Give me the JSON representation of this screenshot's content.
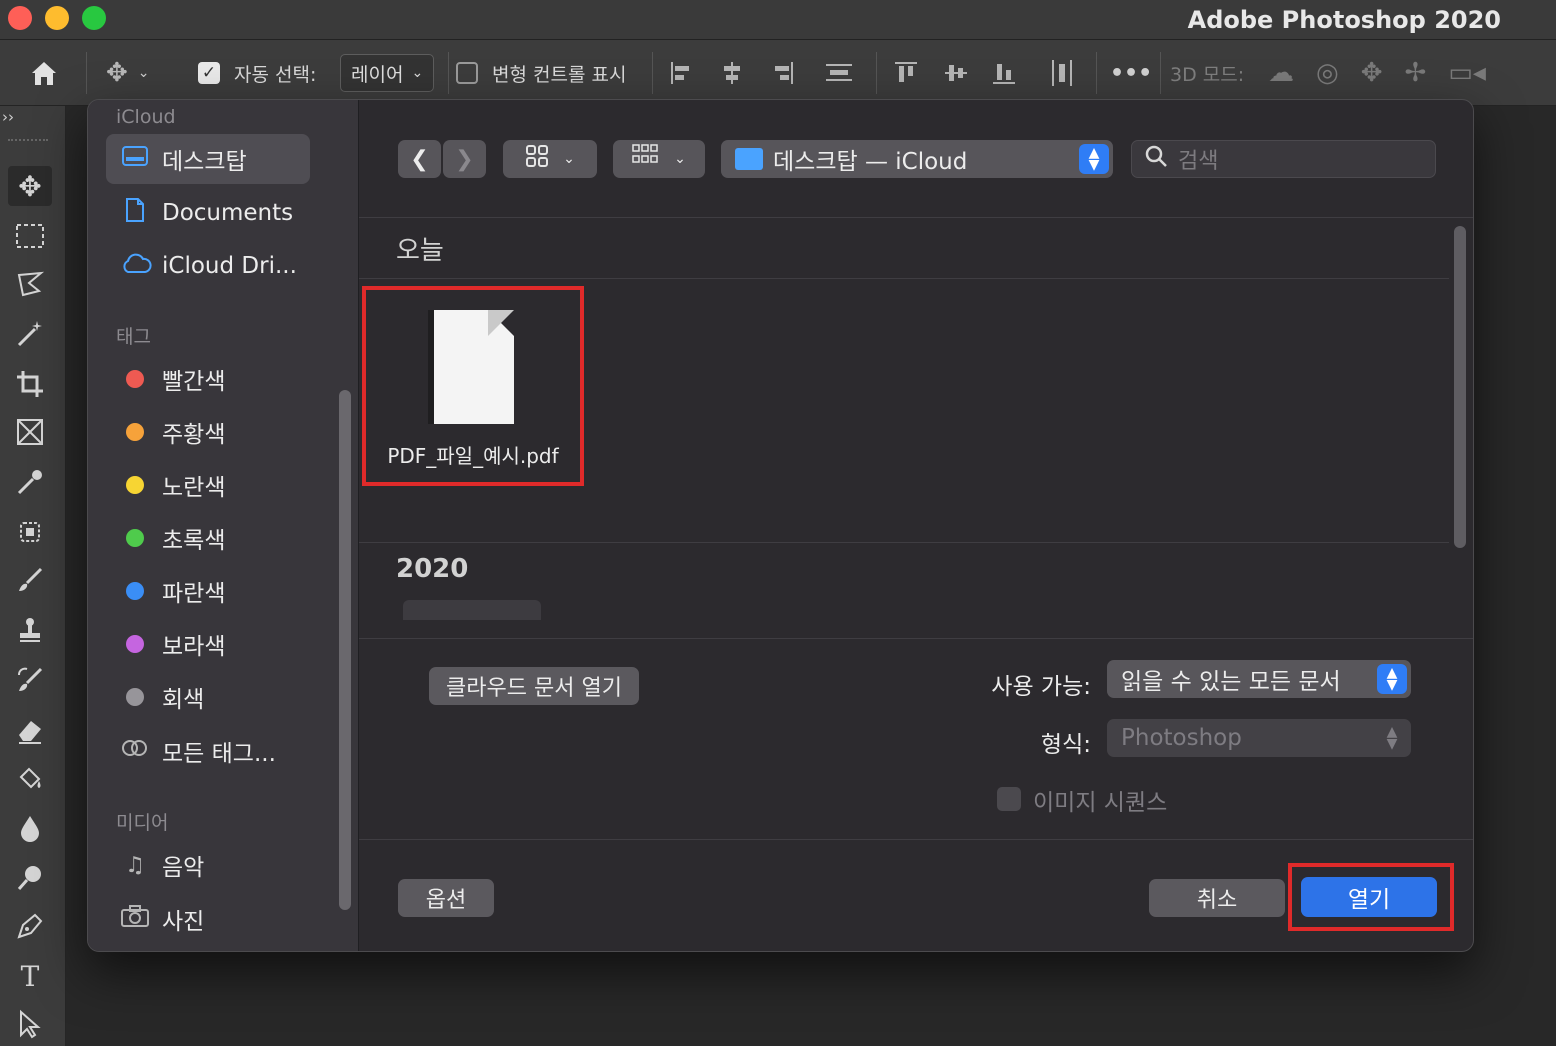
{
  "window": {
    "title": "Adobe Photoshop 2020"
  },
  "options_bar": {
    "auto_select_label": "자동 선택:",
    "auto_select_checked": true,
    "auto_select_target": "레이어",
    "transform_controls_label": "변형 컨트롤 표시",
    "transform_controls_checked": false,
    "more_label": "•••",
    "mode_3d_label": "3D 모드:"
  },
  "tools_panel": {
    "collapse_label": "››"
  },
  "dialog": {
    "sidebar": {
      "section_icloud": "iCloud",
      "icloud_items": [
        {
          "label": "데스크탑",
          "icon": "desktop-icon"
        },
        {
          "label": "Documents",
          "icon": "document-icon"
        },
        {
          "label": "iCloud Dri...",
          "icon": "cloud-icon"
        }
      ],
      "section_tags": "태그",
      "tags": [
        {
          "label": "빨간색",
          "color": "#ee5a52"
        },
        {
          "label": "주황색",
          "color": "#f6a23a"
        },
        {
          "label": "노란색",
          "color": "#f7d533"
        },
        {
          "label": "초록색",
          "color": "#4fcb4c"
        },
        {
          "label": "파란색",
          "color": "#3a8ef6"
        },
        {
          "label": "보라색",
          "color": "#c565e0"
        },
        {
          "label": "회색",
          "color": "#97959a"
        },
        {
          "label": "모든 태그...",
          "color": ""
        }
      ],
      "section_media": "미디어",
      "media_items": [
        {
          "label": "음악",
          "icon": "music-icon"
        },
        {
          "label": "사진",
          "icon": "camera-icon"
        }
      ]
    },
    "toolbar": {
      "location": "데스크탑 — iCloud",
      "search_placeholder": "검색"
    },
    "groups": [
      {
        "title": "오늘",
        "files": [
          {
            "name": "PDF_파일_예시.pdf"
          }
        ]
      },
      {
        "title": "2020"
      }
    ],
    "options": {
      "cloud_docs_button": "클라우드 문서 열기",
      "enable_label": "사용 가능:",
      "enable_value": "읽을 수 있는 모든 문서",
      "format_label": "형식:",
      "format_value": "Photoshop",
      "image_sequence_label": "이미지 시퀀스"
    },
    "footer": {
      "options_button": "옵션",
      "cancel_button": "취소",
      "open_button": "열기"
    }
  },
  "colors": {
    "accent": "#2d73e8",
    "highlight": "#e02a2a"
  }
}
